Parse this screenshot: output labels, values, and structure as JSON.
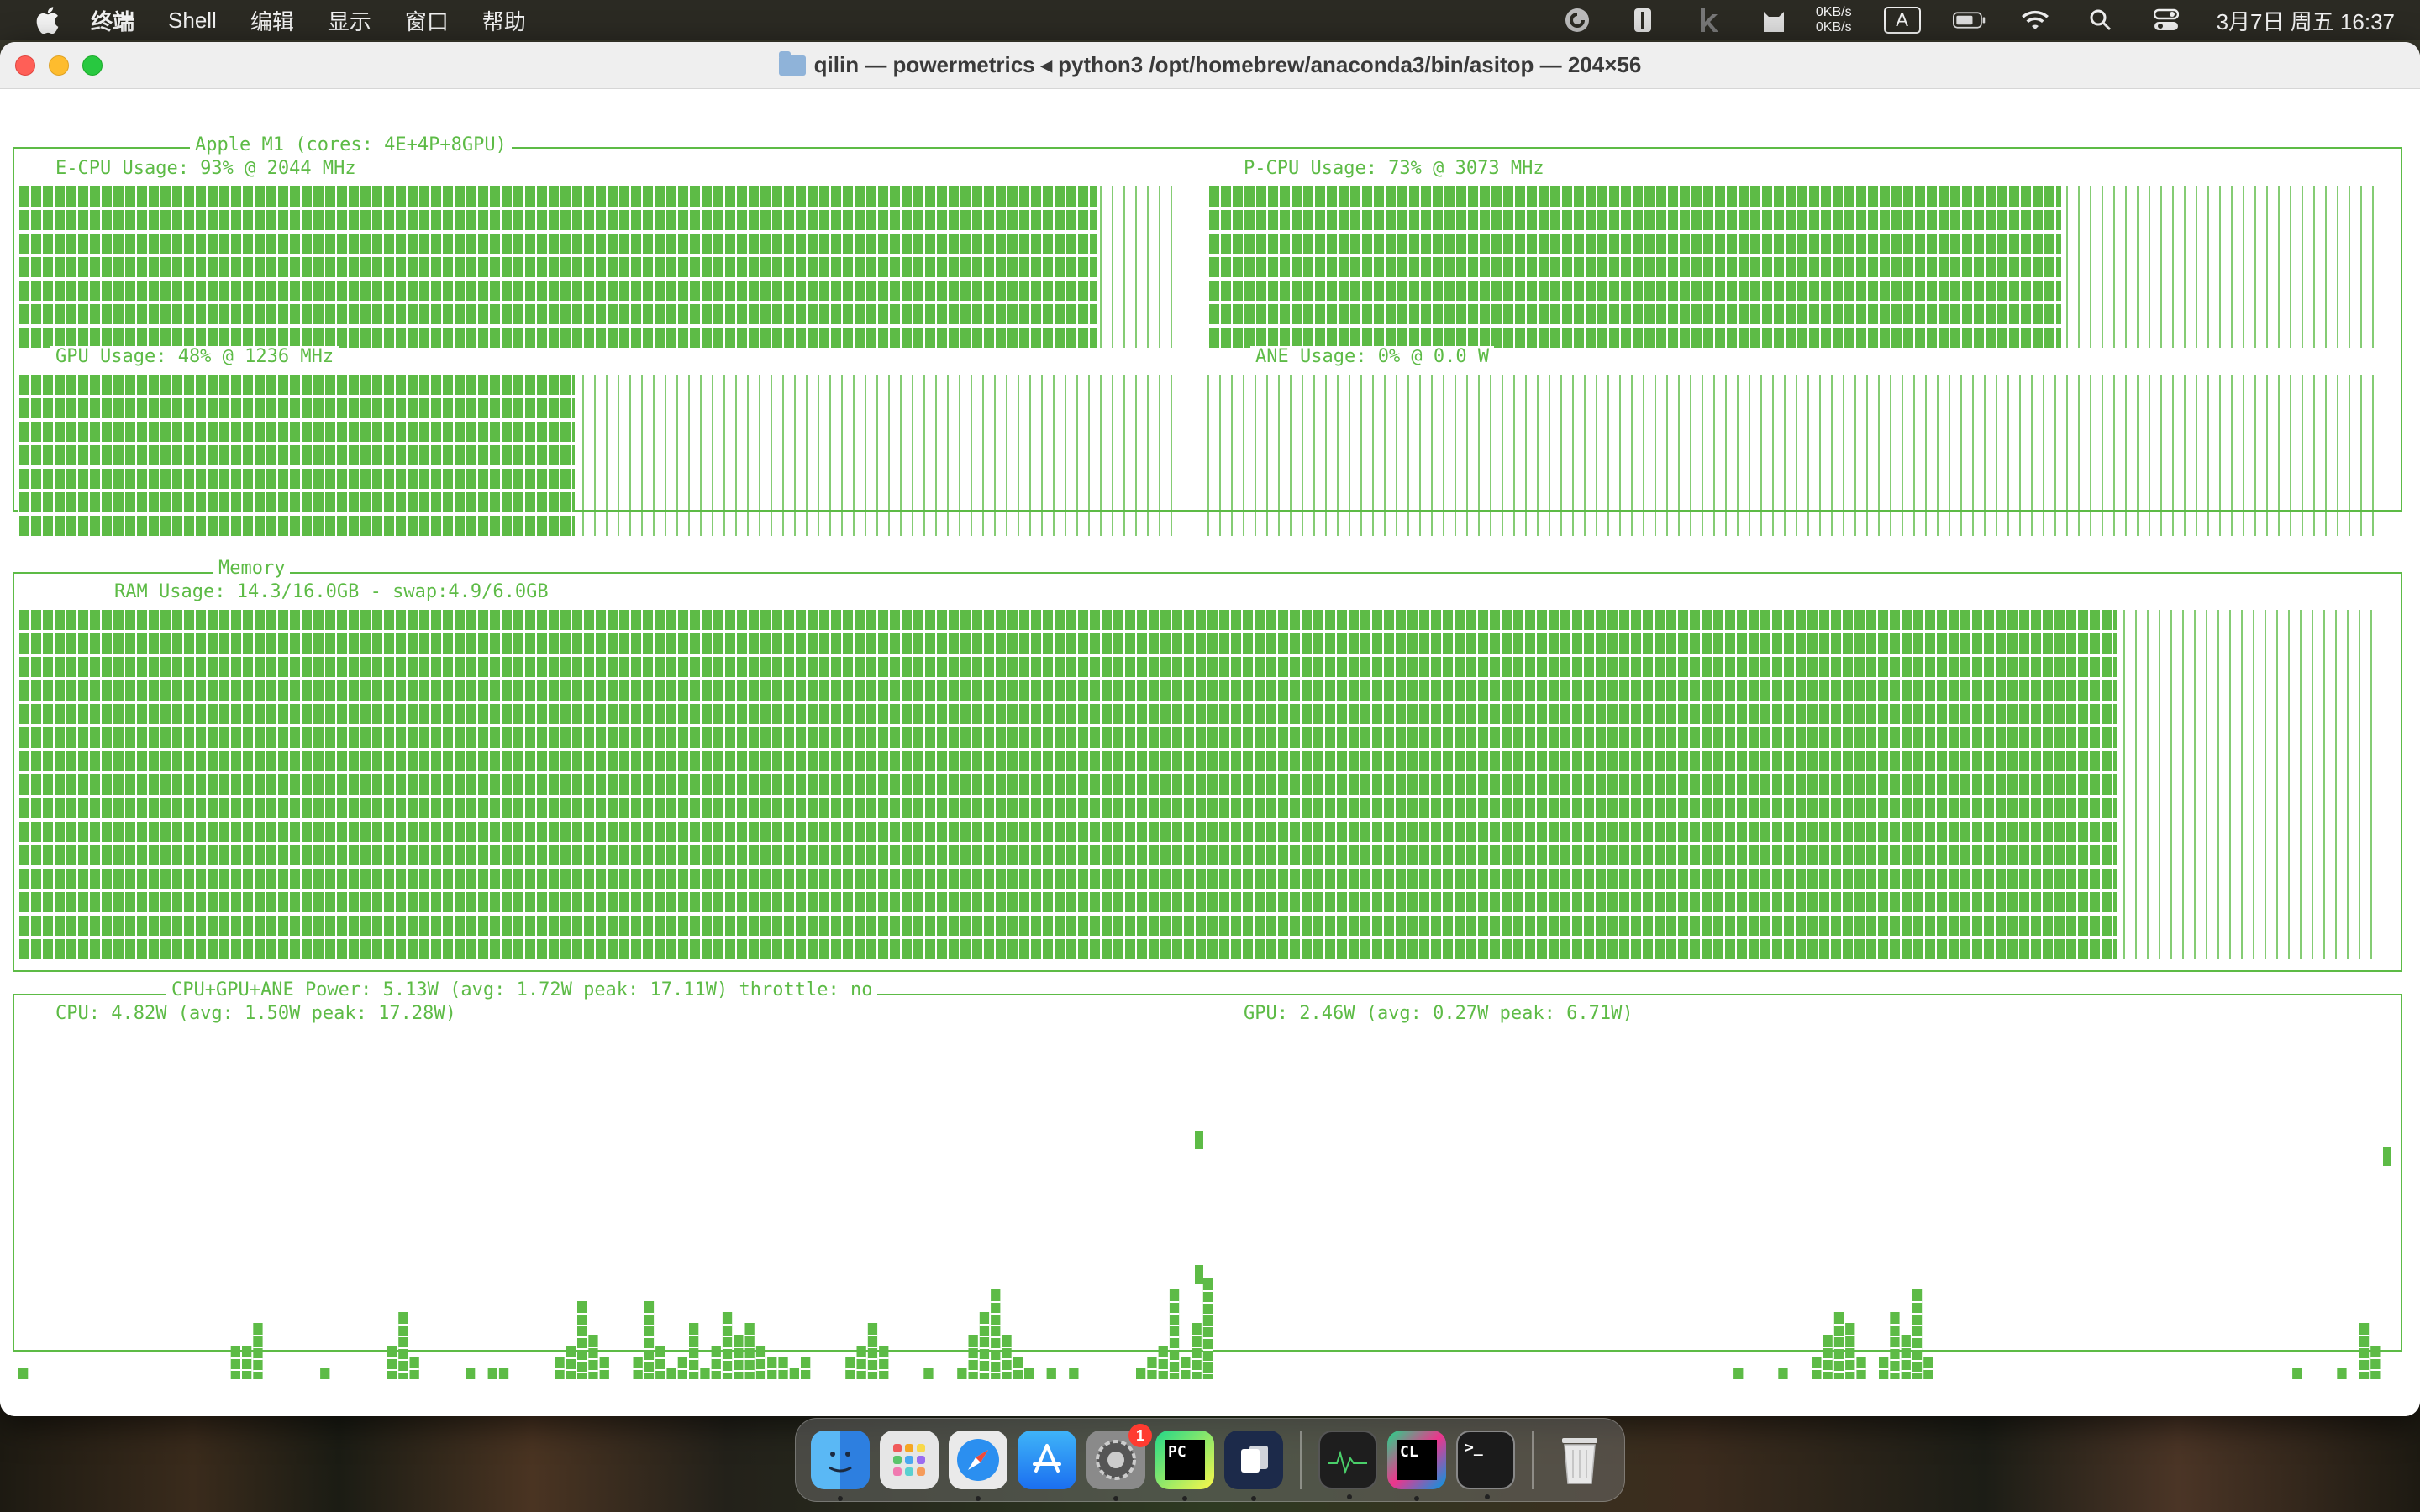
{
  "menubar": {
    "app_name": "终端",
    "items": [
      "Shell",
      "编辑",
      "显示",
      "窗口",
      "帮助"
    ],
    "net_up": "0KB/s",
    "net_down": "0KB/s",
    "input_method": "A",
    "clock": "3月7日 周五 16:37"
  },
  "window": {
    "title": "qilin — powermetrics ◂ python3 /opt/homebrew/anaconda3/bin/asitop — 204×56"
  },
  "asitop": {
    "chip_title": "Apple M1 (cores: 4E+4P+8GPU)",
    "ecpu": {
      "label": "E-CPU Usage: 93% @ 2044 MHz",
      "percent": 93
    },
    "pcpu": {
      "label": "P-CPU Usage: 73% @ 3073 MHz",
      "percent": 73
    },
    "gpu": {
      "label": "GPU Usage: 48% @ 1236 MHz",
      "percent": 48
    },
    "ane": {
      "label": "ANE Usage: 0% @ 0.0 W",
      "percent": 0
    },
    "memory_title": "Memory",
    "ram": {
      "label": "RAM Usage: 14.3/16.0GB - swap:4.9/6.0GB",
      "percent": 89
    },
    "power_title": "CPU+GPU+ANE Power: 5.13W (avg: 1.72W peak: 17.11W) throttle: no",
    "cpu_power_label": "CPU: 4.82W (avg: 1.50W peak: 17.28W)",
    "gpu_power_label": "GPU: 2.46W (avg: 0.27W peak: 6.71W)",
    "cpu_power_history": [
      1,
      0,
      0,
      0,
      0,
      0,
      0,
      0,
      0,
      0,
      0,
      0,
      0,
      0,
      0,
      0,
      0,
      0,
      0,
      3,
      3,
      5,
      0,
      0,
      0,
      0,
      0,
      1,
      0,
      0,
      0,
      0,
      0,
      3,
      6,
      2,
      0,
      0,
      0,
      0,
      1,
      0,
      1,
      1,
      0,
      0,
      0,
      0,
      2,
      3,
      7,
      4,
      2,
      0,
      0,
      2,
      7,
      3,
      1,
      2,
      5,
      1,
      3,
      6,
      4,
      5,
      3,
      2,
      2,
      1,
      2,
      0,
      0,
      0,
      2,
      3,
      5,
      3,
      0,
      0,
      0,
      1,
      0,
      0,
      1,
      4,
      6,
      8,
      4,
      2,
      1,
      0,
      1,
      0,
      1,
      0,
      0,
      0,
      0,
      0,
      1,
      2,
      3,
      8,
      2,
      5,
      9
    ],
    "gpu_power_history": [
      0,
      0,
      0,
      0,
      0,
      0,
      0,
      0,
      0,
      0,
      0,
      0,
      0,
      0,
      0,
      0,
      0,
      0,
      0,
      0,
      0,
      0,
      0,
      0,
      0,
      0,
      0,
      0,
      0,
      0,
      0,
      0,
      0,
      0,
      0,
      0,
      0,
      0,
      0,
      0,
      0,
      0,
      0,
      0,
      0,
      0,
      0,
      1,
      0,
      0,
      0,
      1,
      0,
      0,
      2,
      4,
      6,
      5,
      2,
      0,
      2,
      6,
      4,
      8,
      2,
      0,
      0,
      0,
      0,
      0,
      0,
      0,
      0,
      0,
      0,
      0,
      0,
      0,
      0,
      0,
      0,
      0,
      0,
      0,
      0,
      0,
      0,
      0,
      0,
      0,
      0,
      0,
      0,
      0,
      0,
      0,
      0,
      1,
      0,
      0,
      0,
      1,
      0,
      5,
      3
    ]
  },
  "dock": {
    "apps": [
      "finder",
      "launchpad",
      "safari",
      "app-store",
      "system-settings",
      "pycharm",
      "parallels",
      "activity-monitor",
      "clion",
      "terminal",
      "trash"
    ],
    "settings_badge": "1",
    "pycharm_label": "PC",
    "clion_label": "CL",
    "terminal_label": ">_"
  },
  "colors": {
    "term_green": "#5dbb46"
  }
}
